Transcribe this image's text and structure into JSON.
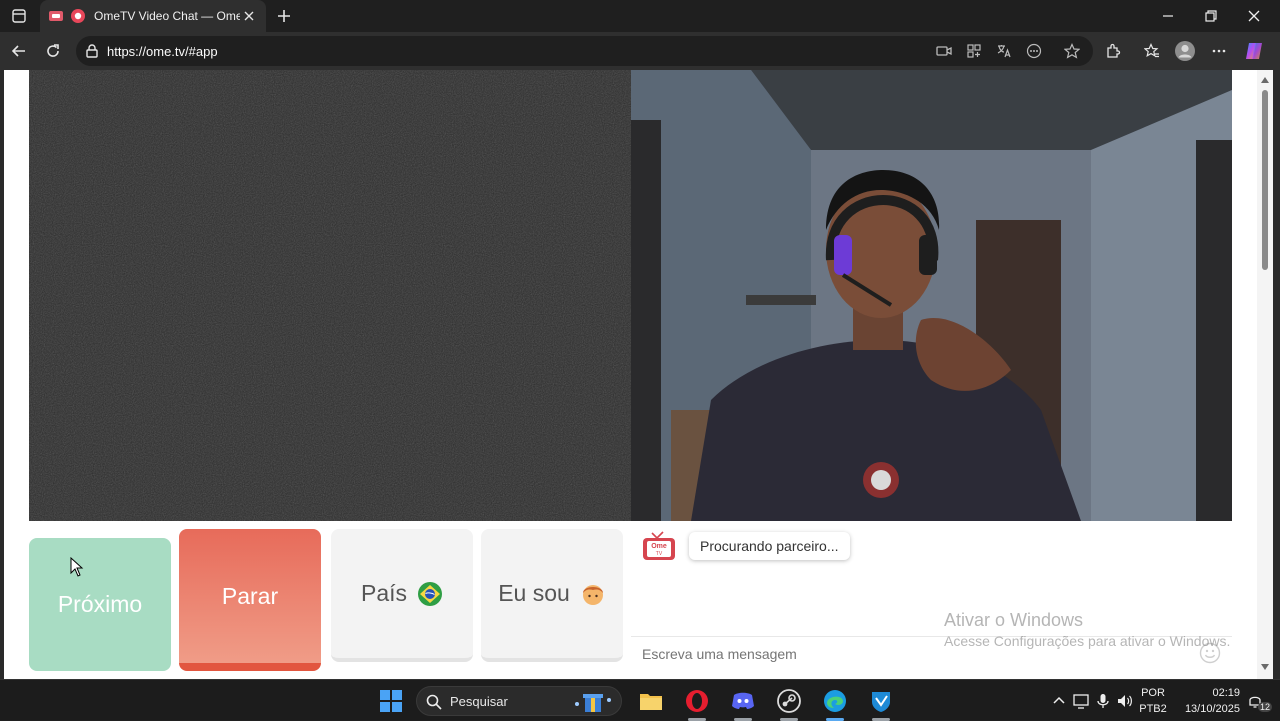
{
  "browser": {
    "tab_title": "OmeTV Video Chat — Omeg",
    "url": "https://ome.tv/#app"
  },
  "chat": {
    "status_message": "Procurando parceiro...",
    "input_placeholder": "Escreva uma mensagem",
    "logo_text": "Ome TV"
  },
  "controls": {
    "next_label": "Próximo",
    "stop_label": "Parar",
    "country_label": "País",
    "iam_label": "Eu sou"
  },
  "watermark": {
    "line1": "Ativar o Windows",
    "line2": "Acesse Configurações para ativar o Windows."
  },
  "taskbar": {
    "search_placeholder": "Pesquisar",
    "language": "POR",
    "layout": "PTB2",
    "time": "02:19",
    "date": "13/10/2025",
    "notification_count": "12"
  },
  "colors": {
    "next_button": "#a8dcc3",
    "stop_button": "#e76b5a",
    "neutral_button": "#f3f3f3"
  }
}
